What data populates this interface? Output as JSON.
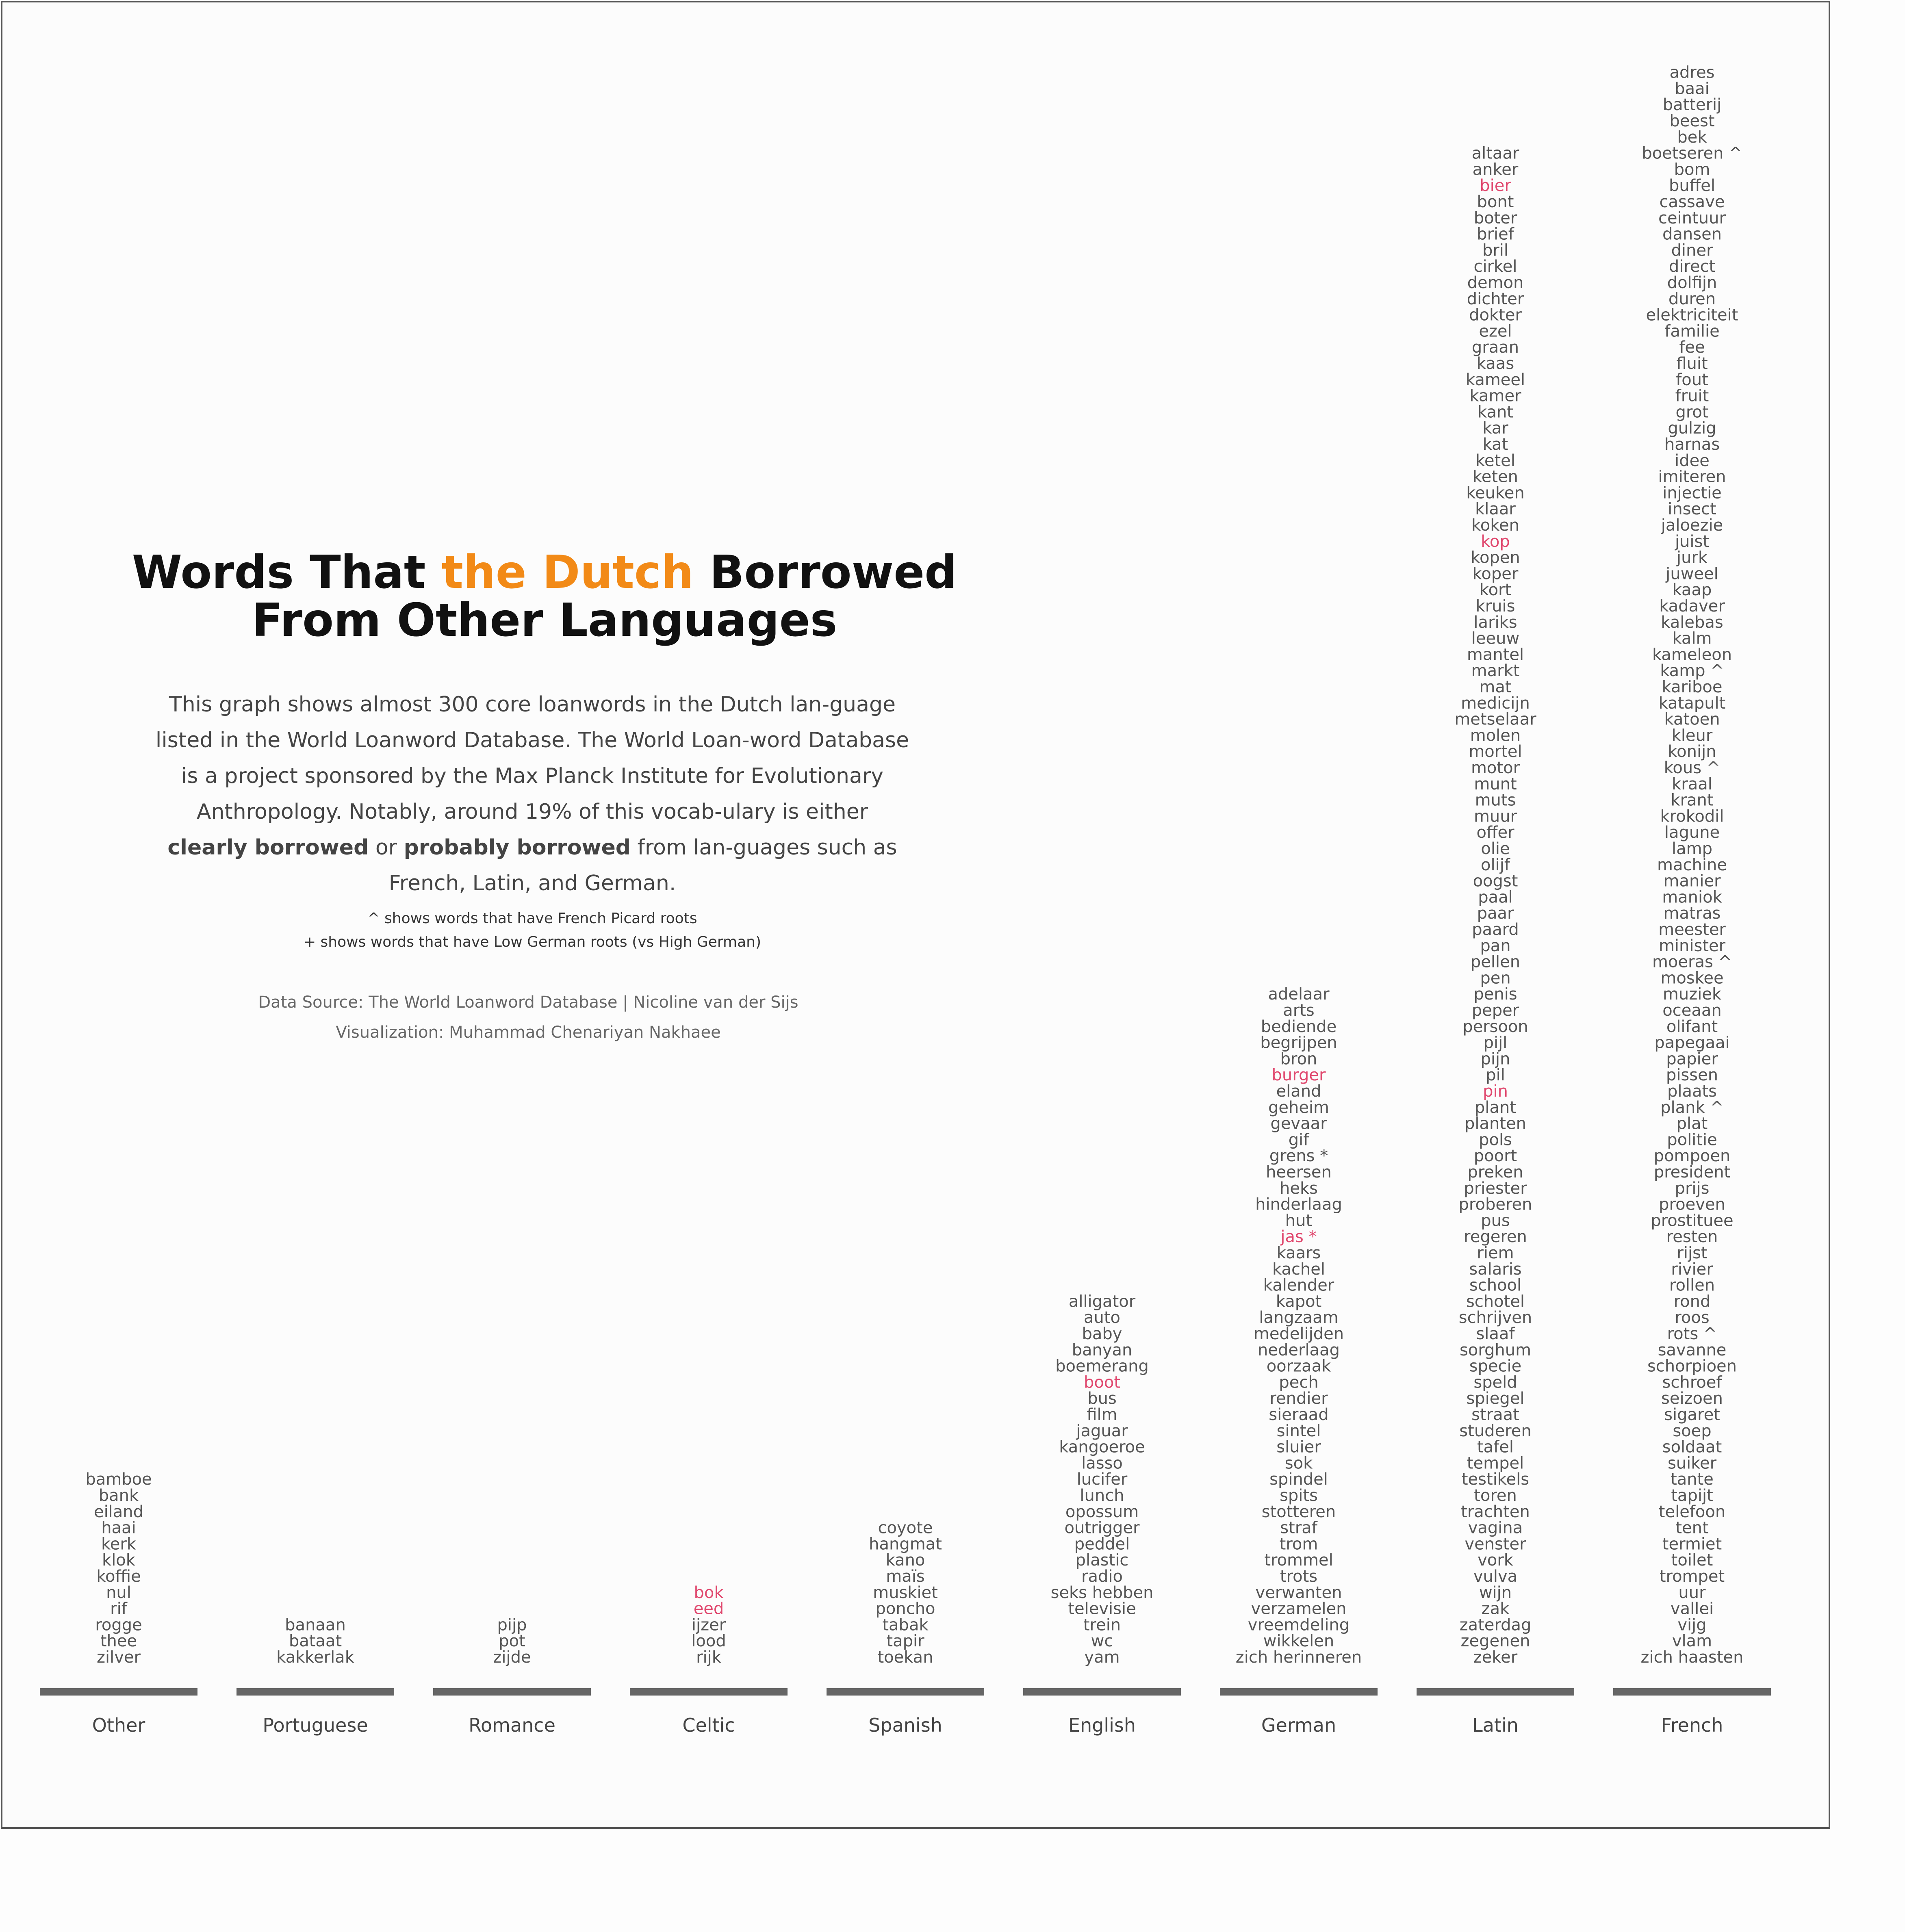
{
  "title": {
    "part1": "Words That ",
    "highlight": "the Dutch",
    "part2": " Borrowed",
    "line2": "From Other Languages"
  },
  "description": {
    "text1": "This graph shows almost 300 core loanwords in the Dutch lan-guage listed in the World Loanword Database. The World Loan-word Database is a project sponsored by the Max Planck Institute for Evolutionary Anthropology.  Notably, around 19% of this vocab-ulary is either ",
    "clearly": "clearly borrowed",
    "or": " or ",
    "probably": "probably borrowed",
    "text2": " from lan-guages such as French, Latin, and German."
  },
  "notes": {
    "picard": "^ shows words that have French Picard roots",
    "lowgerman": "+ shows words that have Low German roots (vs High German)"
  },
  "credits": {
    "source": "Data Source:  The World Loanword Database | Nicoline van der Sijs",
    "viz": "Visualization: Muhammad Chenariyan Nakhaee"
  },
  "colors": {
    "orange": "#f28a17",
    "pink": "#e0486e",
    "word": "#555555",
    "bar": "#666666",
    "label": "#444444"
  },
  "chart_data": {
    "type": "bar",
    "note": "stacked word columns; column height = number of words",
    "categories": [
      "Other",
      "Portuguese",
      "Romance",
      "Celtic",
      "Spanish",
      "English",
      "German",
      "Latin",
      "French"
    ],
    "values": [
      12,
      3,
      3,
      5,
      9,
      23,
      42,
      94,
      99
    ],
    "ylim": [
      0,
      100
    ],
    "series": [
      {
        "category": "Other",
        "words": [
          {
            "w": "bamboe"
          },
          {
            "w": "bank"
          },
          {
            "w": "eiland"
          },
          {
            "w": "haai"
          },
          {
            "w": "kerk"
          },
          {
            "w": "klok"
          },
          {
            "w": "koffie"
          },
          {
            "w": "nul"
          },
          {
            "w": "rif"
          },
          {
            "w": "rogge"
          },
          {
            "w": "thee"
          },
          {
            "w": "zilver"
          }
        ]
      },
      {
        "category": "Portuguese",
        "words": [
          {
            "w": "banaan"
          },
          {
            "w": "bataat"
          },
          {
            "w": "kakkerlak"
          }
        ]
      },
      {
        "category": "Romance",
        "words": [
          {
            "w": "pijp"
          },
          {
            "w": "pot"
          },
          {
            "w": "zijde"
          }
        ]
      },
      {
        "category": "Celtic",
        "words": [
          {
            "w": "bok",
            "p": true
          },
          {
            "w": "eed",
            "p": true
          },
          {
            "w": "ijzer"
          },
          {
            "w": "lood"
          },
          {
            "w": "rijk"
          }
        ]
      },
      {
        "category": "Spanish",
        "words": [
          {
            "w": "coyote"
          },
          {
            "w": "hangmat"
          },
          {
            "w": "kano"
          },
          {
            "w": "maïs"
          },
          {
            "w": "muskiet"
          },
          {
            "w": "poncho"
          },
          {
            "w": "tabak"
          },
          {
            "w": "tapir"
          },
          {
            "w": "toekan"
          }
        ]
      },
      {
        "category": "English",
        "words": [
          {
            "w": "alligator"
          },
          {
            "w": "auto"
          },
          {
            "w": "baby"
          },
          {
            "w": "banyan"
          },
          {
            "w": "boemerang"
          },
          {
            "w": "boot",
            "p": true
          },
          {
            "w": "bus"
          },
          {
            "w": "film"
          },
          {
            "w": "jaguar"
          },
          {
            "w": "kangoeroe"
          },
          {
            "w": "lasso"
          },
          {
            "w": "lucifer"
          },
          {
            "w": "lunch"
          },
          {
            "w": "opossum"
          },
          {
            "w": "outrigger"
          },
          {
            "w": "peddel"
          },
          {
            "w": "plastic"
          },
          {
            "w": "radio"
          },
          {
            "w": "seks hebben"
          },
          {
            "w": "televisie"
          },
          {
            "w": "trein"
          },
          {
            "w": "wc"
          },
          {
            "w": "yam"
          }
        ]
      },
      {
        "category": "German",
        "words": [
          {
            "w": "adelaar"
          },
          {
            "w": "arts"
          },
          {
            "w": "bediende"
          },
          {
            "w": "begrijpen"
          },
          {
            "w": "bron"
          },
          {
            "w": "burger",
            "p": true
          },
          {
            "w": "eland"
          },
          {
            "w": "geheim"
          },
          {
            "w": "gevaar"
          },
          {
            "w": "gif"
          },
          {
            "w": "grens *"
          },
          {
            "w": "heersen"
          },
          {
            "w": "heks"
          },
          {
            "w": "hinderlaag"
          },
          {
            "w": "hut"
          },
          {
            "w": "jas *",
            "p": true
          },
          {
            "w": "kaars"
          },
          {
            "w": "kachel"
          },
          {
            "w": "kalender"
          },
          {
            "w": "kapot"
          },
          {
            "w": "langzaam"
          },
          {
            "w": "medelijden"
          },
          {
            "w": "nederlaag"
          },
          {
            "w": "oorzaak"
          },
          {
            "w": "pech"
          },
          {
            "w": "rendier"
          },
          {
            "w": "sieraad"
          },
          {
            "w": "sintel"
          },
          {
            "w": "sluier"
          },
          {
            "w": "sok"
          },
          {
            "w": "spindel"
          },
          {
            "w": "spits"
          },
          {
            "w": "stotteren"
          },
          {
            "w": "straf"
          },
          {
            "w": "trom"
          },
          {
            "w": "trommel"
          },
          {
            "w": "trots"
          },
          {
            "w": "verwanten"
          },
          {
            "w": "verzamelen"
          },
          {
            "w": "vreemdeling"
          },
          {
            "w": "wikkelen"
          },
          {
            "w": "zich herinneren"
          }
        ]
      },
      {
        "category": "Latin",
        "words": [
          {
            "w": "altaar"
          },
          {
            "w": "anker"
          },
          {
            "w": "bier",
            "p": true
          },
          {
            "w": "bont"
          },
          {
            "w": "boter"
          },
          {
            "w": "brief"
          },
          {
            "w": "bril"
          },
          {
            "w": "cirkel"
          },
          {
            "w": "demon"
          },
          {
            "w": "dichter"
          },
          {
            "w": "dokter"
          },
          {
            "w": "ezel"
          },
          {
            "w": "graan"
          },
          {
            "w": "kaas"
          },
          {
            "w": "kameel"
          },
          {
            "w": "kamer"
          },
          {
            "w": "kant"
          },
          {
            "w": "kar"
          },
          {
            "w": "kat"
          },
          {
            "w": "ketel"
          },
          {
            "w": "keten"
          },
          {
            "w": "keuken"
          },
          {
            "w": "klaar"
          },
          {
            "w": "koken"
          },
          {
            "w": "kop",
            "p": true
          },
          {
            "w": "kopen"
          },
          {
            "w": "koper"
          },
          {
            "w": "kort"
          },
          {
            "w": "kruis"
          },
          {
            "w": "lariks"
          },
          {
            "w": "leeuw"
          },
          {
            "w": "mantel"
          },
          {
            "w": "markt"
          },
          {
            "w": "mat"
          },
          {
            "w": "medicijn"
          },
          {
            "w": "metselaar"
          },
          {
            "w": "molen"
          },
          {
            "w": "mortel"
          },
          {
            "w": "motor"
          },
          {
            "w": "munt"
          },
          {
            "w": "muts"
          },
          {
            "w": "muur"
          },
          {
            "w": "offer"
          },
          {
            "w": "olie"
          },
          {
            "w": "olijf"
          },
          {
            "w": "oogst"
          },
          {
            "w": "paal"
          },
          {
            "w": "paar"
          },
          {
            "w": "paard"
          },
          {
            "w": "pan"
          },
          {
            "w": "pellen"
          },
          {
            "w": "pen"
          },
          {
            "w": "penis"
          },
          {
            "w": "peper"
          },
          {
            "w": "persoon"
          },
          {
            "w": "pijl"
          },
          {
            "w": "pijn"
          },
          {
            "w": "pil"
          },
          {
            "w": "pin",
            "p": true
          },
          {
            "w": "plant"
          },
          {
            "w": "planten"
          },
          {
            "w": "pols"
          },
          {
            "w": "poort"
          },
          {
            "w": "preken"
          },
          {
            "w": "priester"
          },
          {
            "w": "proberen"
          },
          {
            "w": "pus"
          },
          {
            "w": "regeren"
          },
          {
            "w": "riem"
          },
          {
            "w": "salaris"
          },
          {
            "w": "school"
          },
          {
            "w": "schotel"
          },
          {
            "w": "schrijven"
          },
          {
            "w": "slaaf"
          },
          {
            "w": "sorghum"
          },
          {
            "w": "specie"
          },
          {
            "w": "speld"
          },
          {
            "w": "spiegel"
          },
          {
            "w": "straat"
          },
          {
            "w": "studeren"
          },
          {
            "w": "tafel"
          },
          {
            "w": "tempel"
          },
          {
            "w": "testikels"
          },
          {
            "w": "toren"
          },
          {
            "w": "trachten"
          },
          {
            "w": "vagina"
          },
          {
            "w": "venster"
          },
          {
            "w": "vork"
          },
          {
            "w": "vulva"
          },
          {
            "w": "wijn"
          },
          {
            "w": "zak"
          },
          {
            "w": "zaterdag"
          },
          {
            "w": "zegenen"
          },
          {
            "w": "zeker"
          }
        ]
      },
      {
        "category": "French",
        "words": [
          {
            "w": "adres"
          },
          {
            "w": "baai"
          },
          {
            "w": "batterij"
          },
          {
            "w": "beest"
          },
          {
            "w": "bek"
          },
          {
            "w": "boetseren ^"
          },
          {
            "w": "bom"
          },
          {
            "w": "buffel"
          },
          {
            "w": "cassave"
          },
          {
            "w": "ceintuur"
          },
          {
            "w": "dansen"
          },
          {
            "w": "diner"
          },
          {
            "w": "direct"
          },
          {
            "w": "dolfijn"
          },
          {
            "w": "duren"
          },
          {
            "w": "elektriciteit"
          },
          {
            "w": "familie"
          },
          {
            "w": "fee"
          },
          {
            "w": "fluit"
          },
          {
            "w": "fout"
          },
          {
            "w": "fruit"
          },
          {
            "w": "grot"
          },
          {
            "w": "gulzig"
          },
          {
            "w": "harnas"
          },
          {
            "w": "idee"
          },
          {
            "w": "imiteren"
          },
          {
            "w": "injectie"
          },
          {
            "w": "insect"
          },
          {
            "w": "jaloezie"
          },
          {
            "w": "juist"
          },
          {
            "w": "jurk"
          },
          {
            "w": "juweel"
          },
          {
            "w": "kaap"
          },
          {
            "w": "kadaver"
          },
          {
            "w": "kalebas"
          },
          {
            "w": "kalm"
          },
          {
            "w": "kameleon"
          },
          {
            "w": "kamp ^"
          },
          {
            "w": "kariboe"
          },
          {
            "w": "katapult"
          },
          {
            "w": "katoen"
          },
          {
            "w": "kleur"
          },
          {
            "w": "konijn"
          },
          {
            "w": "kous ^"
          },
          {
            "w": "kraal"
          },
          {
            "w": "krant"
          },
          {
            "w": "krokodil"
          },
          {
            "w": "lagune"
          },
          {
            "w": "lamp"
          },
          {
            "w": "machine"
          },
          {
            "w": "manier"
          },
          {
            "w": "maniok"
          },
          {
            "w": "matras"
          },
          {
            "w": "meester"
          },
          {
            "w": "minister"
          },
          {
            "w": "moeras ^"
          },
          {
            "w": "moskee"
          },
          {
            "w": "muziek"
          },
          {
            "w": "oceaan"
          },
          {
            "w": "olifant"
          },
          {
            "w": "papegaai"
          },
          {
            "w": "papier"
          },
          {
            "w": "pissen"
          },
          {
            "w": "plaats"
          },
          {
            "w": "plank ^"
          },
          {
            "w": "plat"
          },
          {
            "w": "politie"
          },
          {
            "w": "pompoen"
          },
          {
            "w": "president"
          },
          {
            "w": "prijs"
          },
          {
            "w": "proeven"
          },
          {
            "w": "prostituee"
          },
          {
            "w": "resten"
          },
          {
            "w": "rijst"
          },
          {
            "w": "rivier"
          },
          {
            "w": "rollen"
          },
          {
            "w": "rond"
          },
          {
            "w": "roos"
          },
          {
            "w": "rots ^"
          },
          {
            "w": "savanne"
          },
          {
            "w": "schorpioen"
          },
          {
            "w": "schroef"
          },
          {
            "w": "seizoen"
          },
          {
            "w": "sigaret"
          },
          {
            "w": "soep"
          },
          {
            "w": "soldaat"
          },
          {
            "w": "suiker"
          },
          {
            "w": "tante"
          },
          {
            "w": "tapijt"
          },
          {
            "w": "telefoon"
          },
          {
            "w": "tent"
          },
          {
            "w": "termiet"
          },
          {
            "w": "toilet"
          },
          {
            "w": "trompet"
          },
          {
            "w": "uur"
          },
          {
            "w": "vallei"
          },
          {
            "w": "vijg"
          },
          {
            "w": "vlam"
          },
          {
            "w": "zich haasten"
          }
        ]
      }
    ]
  }
}
